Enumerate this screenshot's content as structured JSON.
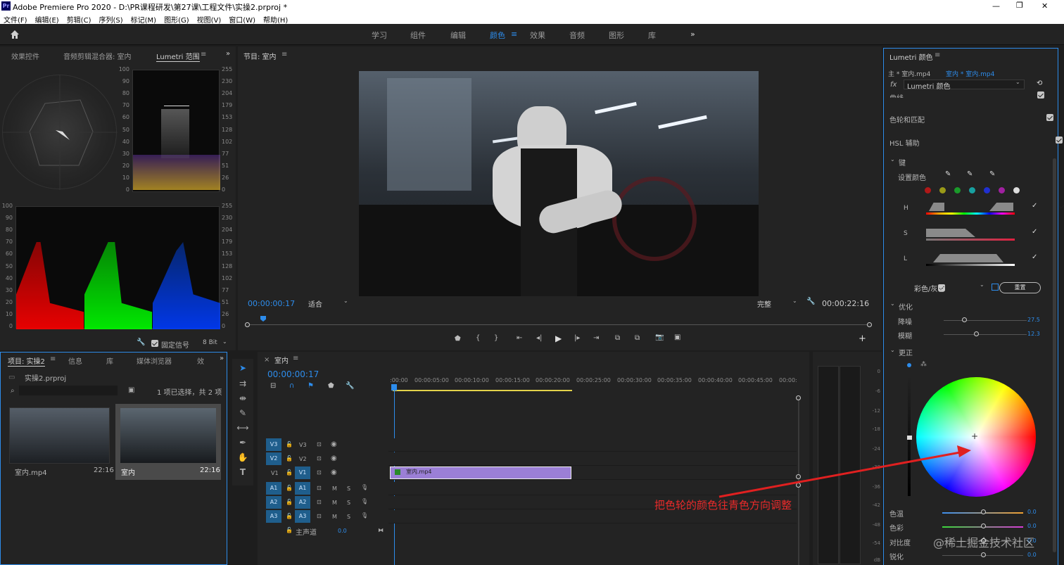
{
  "app": {
    "title": "Adobe Premiere Pro 2020 - D:\\PR课程研发\\第27课\\工程文件\\实操2.prproj *",
    "icon": "Pr"
  },
  "window_controls": [
    "—",
    "❐",
    "✕"
  ],
  "menu": [
    "文件(F)",
    "编辑(E)",
    "剪辑(C)",
    "序列(S)",
    "标记(M)",
    "图形(G)",
    "视图(V)",
    "窗口(W)",
    "帮助(H)"
  ],
  "workspaces": {
    "items": [
      "学习",
      "组件",
      "编辑",
      "颜色",
      "效果",
      "音频",
      "图形",
      "库"
    ],
    "active": "颜色",
    "more": "»"
  },
  "left_panel": {
    "tabs": [
      "效果控件",
      "音频剪辑混合器: 室内",
      "Lumetri 范围"
    ],
    "active_tab": "Lumetri 范围",
    "scale_left": [
      "100",
      "90",
      "80",
      "70",
      "60",
      "50",
      "40",
      "30",
      "20",
      "10",
      "0"
    ],
    "scale_right": [
      "255",
      "230",
      "204",
      "179",
      "153",
      "128",
      "102",
      "77",
      "51",
      "26",
      "0"
    ],
    "clamp_label": "固定信号",
    "bit_depth": "8 Bit"
  },
  "program": {
    "title": "节目: 室内",
    "timecode": "00:00:00:17",
    "fit": "适合",
    "quality": "完整",
    "duration": "00:00:22:16"
  },
  "project": {
    "tabs": [
      "项目: 实操2",
      "信息",
      "库",
      "媒体浏览器",
      "效"
    ],
    "file": "实操2.prproj",
    "selection": "1 项已选择，共 2 项",
    "items": [
      {
        "name": "室内.mp4",
        "duration": "22:16"
      },
      {
        "name": "室内",
        "duration": "22:16"
      }
    ]
  },
  "timeline": {
    "title": "室内",
    "timecode": "00:00:00:17",
    "ruler": [
      ":00:00",
      "00:00:05:00",
      "00:00:10:00",
      "00:00:15:00",
      "00:00:20:00",
      "00:00:25:00",
      "00:00:30:00",
      "00:00:35:00",
      "00:00:40:00",
      "00:00:45:00",
      "00:00:"
    ],
    "video_tracks": [
      {
        "src": "V3",
        "name": "V3"
      },
      {
        "src": "V2",
        "name": "V2"
      },
      {
        "src": "V1",
        "name": "V1"
      }
    ],
    "audio_tracks": [
      {
        "src": "A1",
        "name": "A1"
      },
      {
        "src": "A2",
        "name": "A2"
      },
      {
        "src": "A3",
        "name": "A3"
      }
    ],
    "master": "主声道",
    "master_val": "0.0",
    "clip": "室内.mp4",
    "mute": "M",
    "solo": "S"
  },
  "meter": {
    "scale": [
      "0",
      "-6",
      "-12",
      "-18",
      "-24",
      "-30",
      "-36",
      "-42",
      "-48",
      "-54",
      "dB"
    ]
  },
  "lumetri": {
    "title": "Lumetri 颜色",
    "master_clip": "主 * 室内.mp4",
    "seq_clip": "室内 * 室内.mp4",
    "fx_label": "fx",
    "effect": "Lumetri 颜色",
    "sections": [
      "曲线",
      "色轮和匹配",
      "HSL 辅助"
    ],
    "key": "键",
    "set_color": "设置颜色",
    "hsl": [
      "H",
      "S",
      "L"
    ],
    "color_gray": "彩色/灰色",
    "reset": "重置",
    "refine": "优化",
    "denoise": "降噪",
    "denoise_val": "27.5",
    "blur": "模糊",
    "blur_val": "12.3",
    "correction": "更正",
    "temp": "色温",
    "temp_val": "0.0",
    "tint": "色彩",
    "tint_val": "0.0",
    "contrast": "对比度",
    "contrast_val": "0.0",
    "sharpen": "锐化",
    "sharpen_val": "0.0"
  },
  "annotation": "把色轮的颜色往青色方向调整",
  "watermark": "@稀土掘金技术社区"
}
